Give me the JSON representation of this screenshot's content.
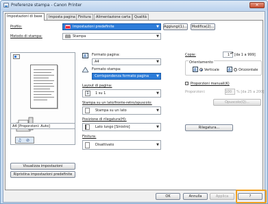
{
  "window": {
    "title": "Preferenze stampa - Canon Printer",
    "close_label": "✕"
  },
  "tabs": [
    {
      "label": "Impostazioni di base",
      "active": true
    },
    {
      "label": "Imposta pagina",
      "active": false
    },
    {
      "label": "Finitura",
      "active": false
    },
    {
      "label": "Alimentazione carta",
      "active": false
    },
    {
      "label": "Qualità",
      "active": false
    }
  ],
  "profile": {
    "label": "Profilo:",
    "value": "Impostazioni predefinite",
    "add_button": "Aggiungi(1)...",
    "edit_button": "Modifica(2)..."
  },
  "output_method": {
    "label": "Metodo di stampa:",
    "value": "Stampa"
  },
  "preview": {
    "caption": "A4 [Proporzioni: Auto]"
  },
  "left_buttons": {
    "view_settings": "Visualizza impostazioni",
    "restore_defaults": "Ripristina impostazioni predefinite"
  },
  "page_size": {
    "label": "Formato pagina:",
    "value": "A4"
  },
  "output_size": {
    "label": "Formato stampa:",
    "value": "Corrispondenza formato pagina"
  },
  "page_layout": {
    "label": "Layout di pagina:",
    "value": "1 su 1"
  },
  "duplex": {
    "label": "Stampa su un lato/fronte-retro/opuscolo:",
    "value": "Stampa su un lato"
  },
  "binding": {
    "label": "Posizione di rilegatura(H):",
    "value": "Lato lungo [Sinistro]",
    "button": "Rilegatura..."
  },
  "finishing": {
    "label": "Finitura:",
    "value": "Disattivato"
  },
  "copies": {
    "label": "Copie:",
    "value": "1",
    "range": "[da 1 a 999]"
  },
  "orientation": {
    "label": "Orientamento",
    "portrait": "Verticale",
    "landscape": "Orizzontale",
    "selected": "portrait"
  },
  "manual_scaling": {
    "label": "Proporzioni manuali(K)",
    "scaling_label": "Proporzioni:",
    "scaling_value": "100",
    "scaling_range": "% [da 25 a 200]"
  },
  "booklet": {
    "button": "Opuscolo(Q)..."
  },
  "bottom": {
    "ok": "OK",
    "cancel": "Annulla",
    "apply": "Applica",
    "help": "?"
  },
  "icons": {
    "A": "A"
  }
}
